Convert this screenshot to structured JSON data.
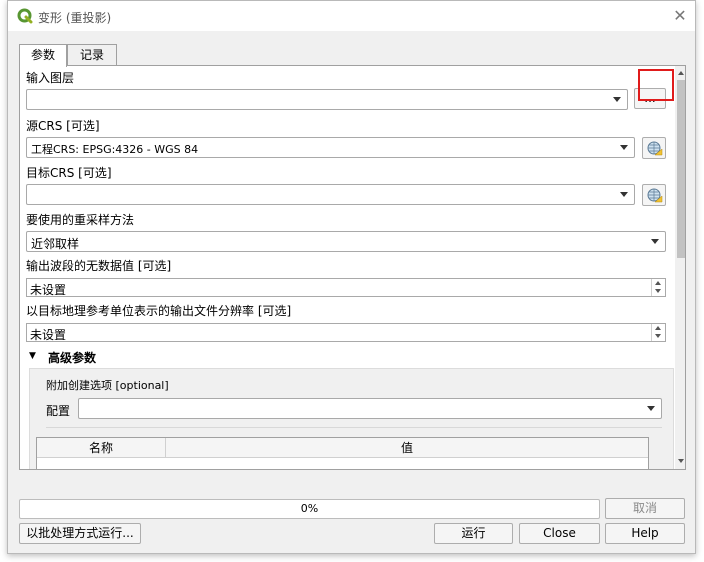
{
  "window": {
    "title": "变形 (重投影)"
  },
  "tabs": [
    {
      "label": "参数"
    },
    {
      "label": "记录"
    }
  ],
  "params": {
    "input_layer": {
      "label": "输入图层",
      "value": "",
      "browse_label": "..."
    },
    "source_crs": {
      "label": "源CRS [可选]",
      "value": "工程CRS: EPSG:4326 - WGS 84"
    },
    "target_crs": {
      "label": "目标CRS [可选]",
      "value": ""
    },
    "resampling": {
      "label": "要使用的重采样方法",
      "value": "近邻取样"
    },
    "nodata": {
      "label": "输出波段的无数据值 [可选]",
      "value": "未设置"
    },
    "resolution": {
      "label": "以目标地理参考单位表示的输出文件分辨率 [可选]",
      "value": "未设置"
    },
    "advanced": {
      "label": "高级参数",
      "create_options_label": "附加创建选项 [optional]",
      "profile_label": "配置",
      "profile_value": "",
      "table_headers": [
        "名称",
        "值"
      ]
    }
  },
  "progress": {
    "percent": 0,
    "text": "0%"
  },
  "buttons": {
    "cancel": "取消",
    "batch": "以批处理方式运行...",
    "run": "运行",
    "close": "Close",
    "help": "Help"
  },
  "icons": {
    "app": "qgis-logo-icon",
    "crs": "globe-crs-icon"
  }
}
